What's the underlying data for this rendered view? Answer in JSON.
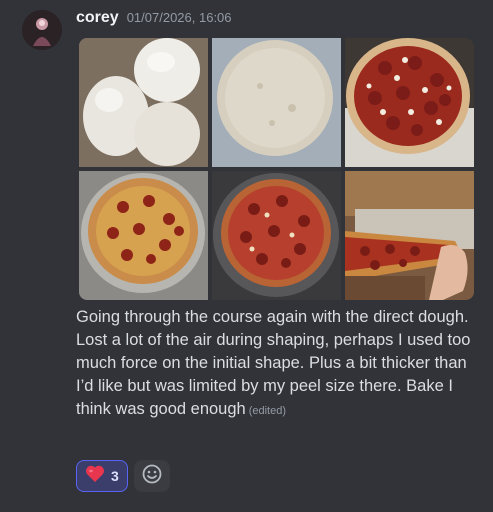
{
  "message": {
    "author": "corey",
    "timestamp": "01/07/2026, 16:06",
    "content": "Going through the course again with the direct dough. Lost a lot of the air during shaping, perhaps I used too much force on the initial shape. Plus a bit thicker than I’d like but was limited by my peel size there. Bake I think was good enough",
    "edited_label": "(edited)",
    "attachments": [
      {
        "name": "dough-balls-photo"
      },
      {
        "name": "stretched-dough-photo"
      },
      {
        "name": "pepperoni-pizza-on-peel-photo"
      },
      {
        "name": "baked-pizza-on-screen-photo"
      },
      {
        "name": "baked-pizza-on-pan-photo"
      },
      {
        "name": "pizza-slice-held-photo"
      }
    ],
    "reactions": [
      {
        "emoji": "heart-emoji",
        "count": "3",
        "reacted": true
      }
    ]
  },
  "colors": {
    "background": "#313338",
    "username": "#f2f3f5",
    "timestamp": "#949ba4",
    "text": "#dbdee1",
    "reaction_active_bg": "#3b3e6b",
    "reaction_active_border": "#5865f2"
  }
}
